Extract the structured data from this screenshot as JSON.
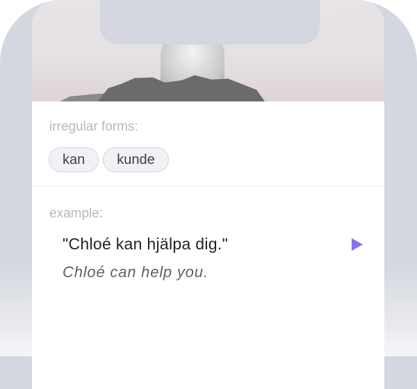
{
  "irregular_forms": {
    "label": "irregular forms:",
    "chips": [
      "kan",
      "kunde"
    ]
  },
  "example": {
    "label": "example:",
    "sentence": "\"Chloé kan hjälpa dig.\"",
    "translation": "Chloé can help you.",
    "play_icon": "play-icon",
    "accent_color": "#8b6ff0"
  },
  "colors": {
    "bezel": "#d4d7df",
    "label_text": "#b4b8bf",
    "chip_border": "#cfd3da"
  }
}
